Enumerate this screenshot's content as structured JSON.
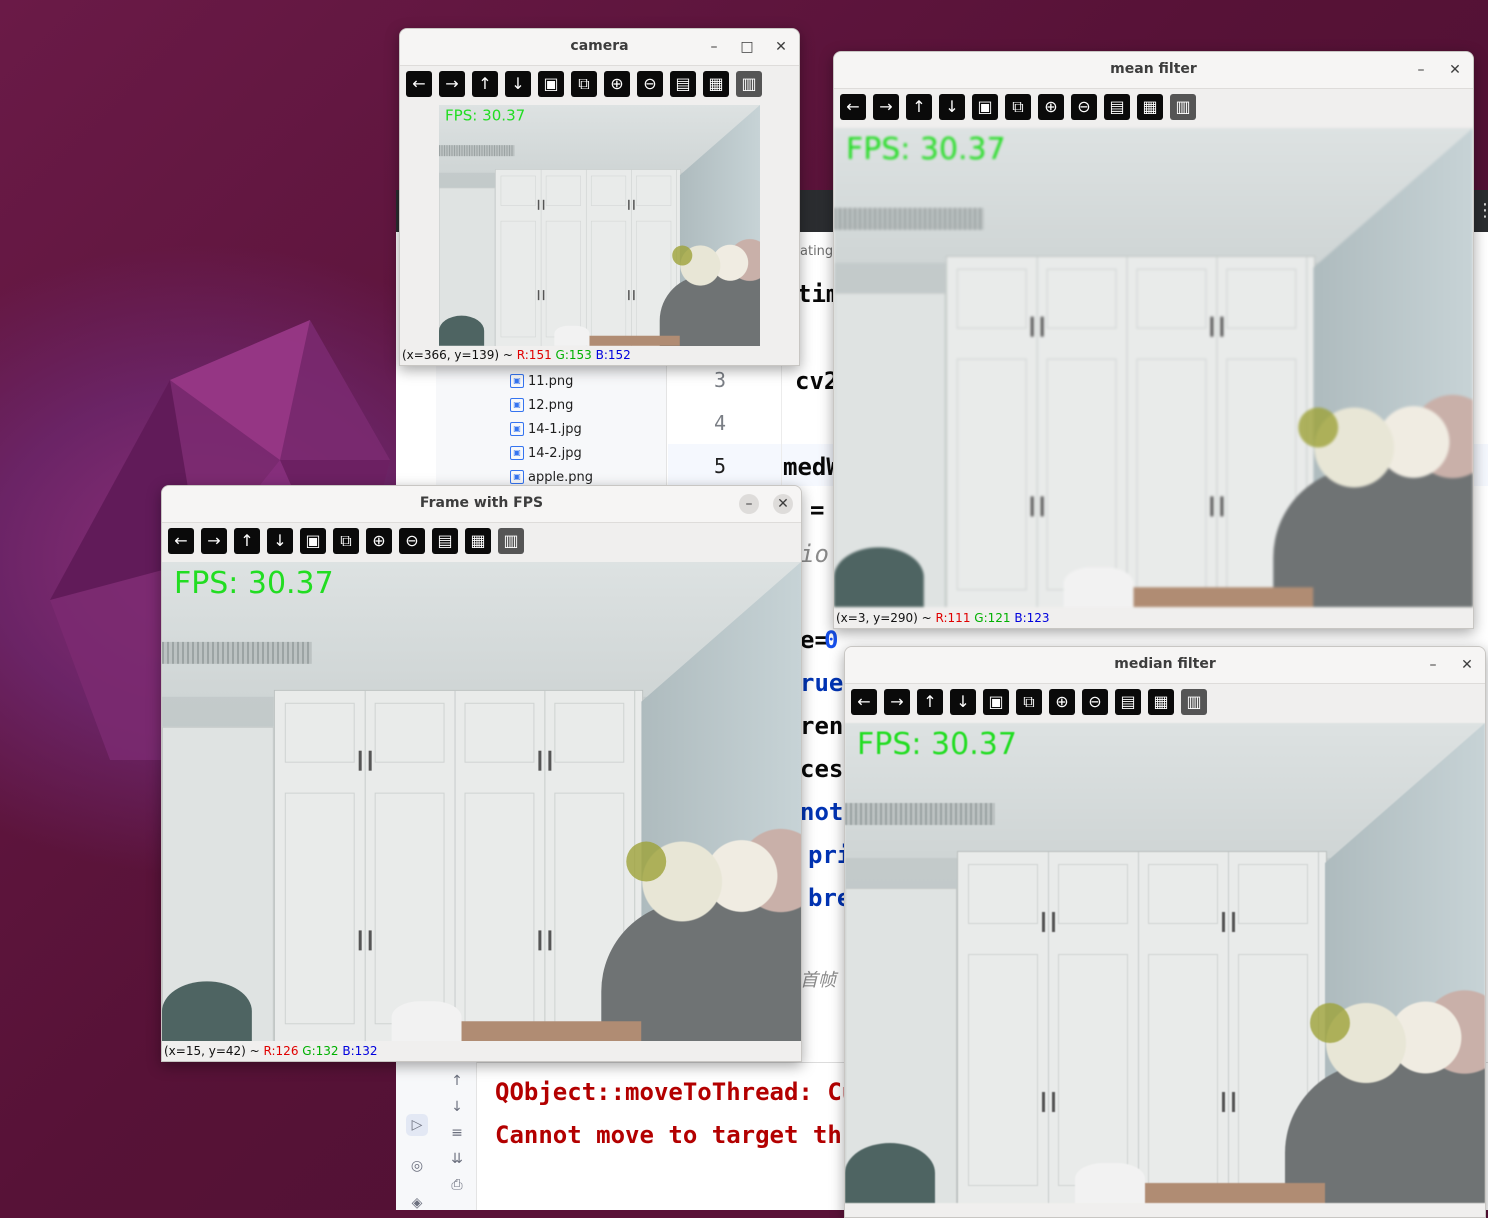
{
  "ide": {
    "tab_fragment": "ating.p",
    "tree_files": [
      "11.png",
      "12.png",
      "14-1.jpg",
      "14-2.jpg",
      "apple.png"
    ],
    "line_numbers": [
      "3",
      "4",
      "5"
    ],
    "code_fragments": {
      "tim": "tim",
      "cv2": "cv2",
      "medW": "medW",
      "eq": "=",
      "io": "io",
      "e0a": "e=",
      "e0b": "0",
      "rue": "rue:",
      "rent": "rent",
      "cess": "cess",
      "not": "not",
      "pri": "pri",
      "bre": "bre",
      "comment2": "首帧"
    },
    "console_lines": [
      "QObject::moveToThread: Cu",
      "Cannot move to target thr"
    ]
  },
  "windows": {
    "camera": {
      "title": "camera",
      "fps": "FPS: 30.37",
      "status": {
        "xy": "(x=366, y=139) ~ ",
        "r": "R:151",
        "g": "G:153",
        "b": "B:152"
      }
    },
    "mean": {
      "title": "mean filter",
      "fps": "FPS: 30.37",
      "status": {
        "xy": "(x=3, y=290) ~ ",
        "r": "R:111",
        "g": "G:121",
        "b": "B:123"
      }
    },
    "frame": {
      "title": "Frame with FPS",
      "fps": "FPS: 30.37",
      "status": {
        "xy": "(x=15, y=42) ~ ",
        "r": "R:126",
        "g": "G:132",
        "b": "B:132"
      }
    },
    "median": {
      "title": "median filter",
      "fps": "FPS: 30.37"
    }
  },
  "toolbar_icons": [
    "pan-left-icon",
    "pan-right-icon",
    "pan-up-icon",
    "pan-down-icon",
    "zoom-fit-icon",
    "zoom-original-icon",
    "zoom-in-icon",
    "zoom-out-icon",
    "save-icon",
    "properties-icon",
    "panel-icon"
  ],
  "window_controls": {
    "minimize": "–",
    "maximize": "□",
    "close": "✕"
  },
  "colors": {
    "fps_text": "#22dd22",
    "status_r": "#e00000",
    "status_g": "#00b000",
    "status_b": "#0000dd"
  }
}
